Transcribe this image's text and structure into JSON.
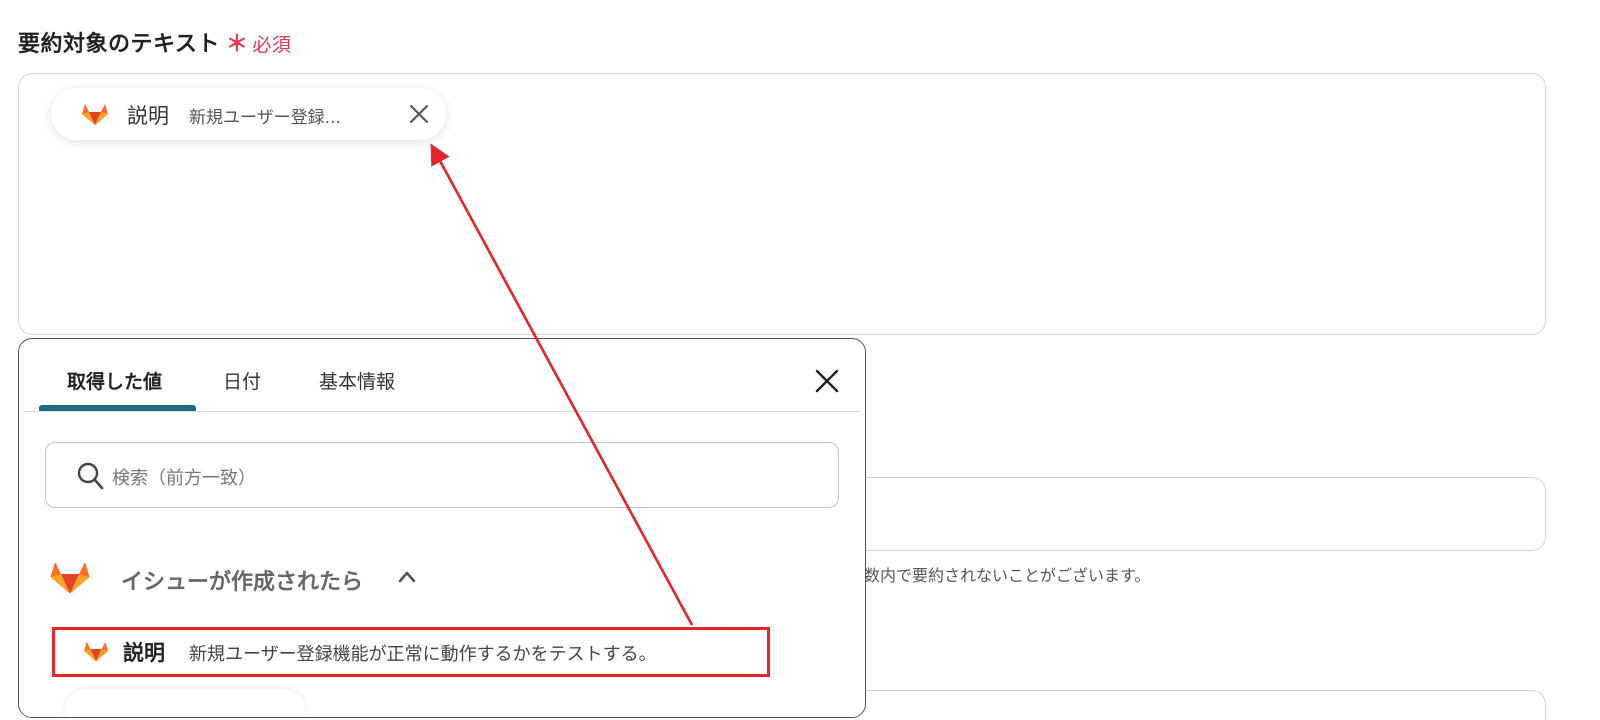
{
  "field": {
    "label": "要約対象のテキスト",
    "required_mark": "＊",
    "required_text": "必須"
  },
  "pill": {
    "icon": "gitlab-icon",
    "name": "説明",
    "value": "新規ユーザー登録..."
  },
  "background_hint": "数内で要約されないことがございます。",
  "panel": {
    "tabs": [
      {
        "label": "取得した値",
        "active": true
      },
      {
        "label": "日付",
        "active": false
      },
      {
        "label": "基本情報",
        "active": false
      }
    ],
    "search_placeholder": "検索（前方一致）",
    "group": {
      "icon": "gitlab-icon",
      "title": "イシューが作成されたら",
      "expanded": true
    },
    "items": [
      {
        "icon": "gitlab-icon",
        "name": "説明",
        "value": "新規ユーザー登録機能が正常に動作するかをテストする。"
      }
    ]
  },
  "colors": {
    "required": "#e8384f",
    "tab_indicator": "#1c6b7f",
    "annotation": "#e8232a",
    "gitlab_orange": "#fc6d26"
  }
}
